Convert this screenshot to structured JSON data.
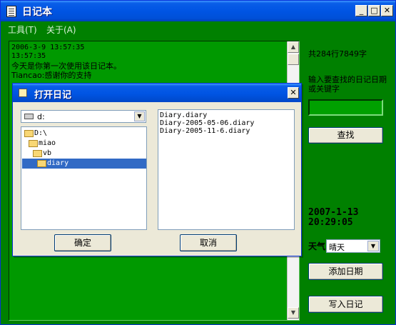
{
  "window": {
    "title": "日记本"
  },
  "menu": [
    {
      "label": "工具(T)"
    },
    {
      "label": "关于(A)"
    }
  ],
  "log": {
    "lines": [
      "2006-3-9 13:57:35",
      "13:57:35",
      "今天是你第一次使用该日记本。",
      "Tiancao:感谢你的支持"
    ]
  },
  "panel": {
    "stat": "共284行7849字",
    "search_prompt": "输入要查找的日记日期或关键字",
    "search_value": "",
    "search_button": "查找",
    "date": "2007-1-13",
    "time": "20:29:05",
    "weather_label": "天气",
    "weather_value": "晴天",
    "add_date_button": "添加日期",
    "write_button": "写入日记"
  },
  "dialog": {
    "title": "打开日记",
    "drive": "d:",
    "dirs": [
      "D:\\",
      "miao",
      "vb",
      "diary"
    ],
    "selected_dir": "diary",
    "files": [
      "Diary.diary",
      "Diary-2005-05-06.diary",
      "Diary-2005-11-6.diary"
    ],
    "ok_button": "确定",
    "cancel_button": "取消"
  }
}
